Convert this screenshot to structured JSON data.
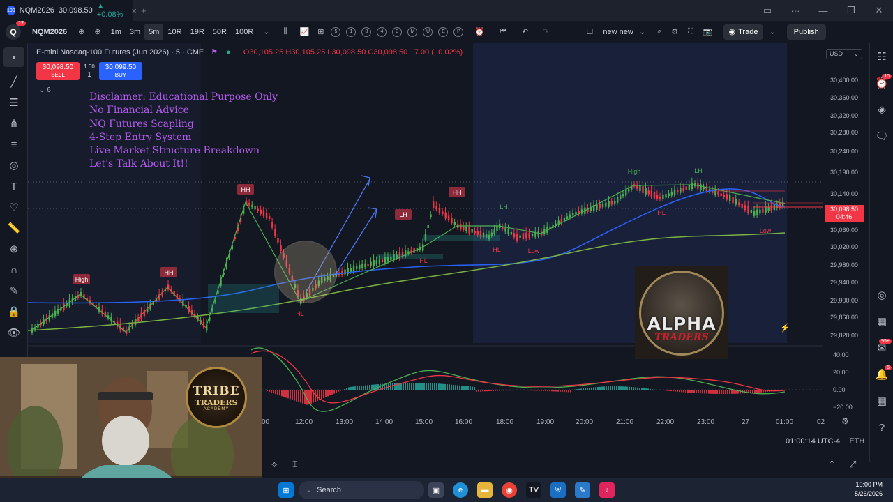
{
  "window": {
    "tab_title": "NQM2026",
    "tab_price": "30,098.50",
    "tab_change": "▲ +0.08%",
    "tab_icon": "100"
  },
  "toolbar": {
    "logo_badge": "12",
    "symbol": "NQM2026",
    "intervals": [
      "1m",
      "3m",
      "5m",
      "10R",
      "19R",
      "50R",
      "100R"
    ],
    "active_interval": "5m",
    "hotkeys": [
      "5",
      "1",
      "8",
      "4",
      "3",
      "M",
      "U",
      "E",
      "P"
    ],
    "layout_name": "new new",
    "trade_label": "Trade",
    "publish_label": "Publish"
  },
  "legend": {
    "title": "E-mini Nasdaq-100 Futures (Jun 2026) · 5 · CME",
    "ohlc": "O30,105.25 H30,105.25 L30,098.50 C30,098.50 −7.00 (−0.02%)"
  },
  "order": {
    "sell_price": "30,098.50",
    "sell_label": "SELL",
    "buy_price": "30,099.50",
    "buy_label": "BUY",
    "spread": "1.00",
    "qty": "1"
  },
  "collapsed_indicators": "⌄ 6",
  "disclaimer": [
    "Disclaimer: Educational Purpose Only",
    "No Financial Advice",
    "NQ Futures Scapling",
    "4-Step Entry System",
    "Live Market Structure Breakdown",
    "Let's Talk About It!!"
  ],
  "price_axis": {
    "currency": "USD",
    "ticks": [
      "30,400.00",
      "30,360.00",
      "30,320.00",
      "30,280.00",
      "30,240.00",
      "30,190.00",
      "30,140.00",
      "30,060.00",
      "30,020.00",
      "29,980.00",
      "29,940.00",
      "29,900.00",
      "29,860.00",
      "29,820.00"
    ],
    "last_price": "30,098.50",
    "countdown": "04:46",
    "macd_ticks": [
      "40.00",
      "20.00",
      "0.00",
      "−20.00"
    ]
  },
  "time_axis": [
    "00",
    "12:00",
    "13:00",
    "14:00",
    "15:00",
    "16:00",
    "18:00",
    "19:00",
    "20:00",
    "21:00",
    "22:00",
    "23:00",
    "27",
    "01:00",
    "02"
  ],
  "status": {
    "time": "01:00:14 UTC-4",
    "session": "ETH"
  },
  "structure_labels": {
    "high": "High",
    "hh": "HH",
    "lh": "LH",
    "hl": "HL",
    "low": "Low"
  },
  "overlay_logos": {
    "tribe_line1": "TRIBE",
    "tribe_line2": "TRADERS",
    "tribe_line3": "ACADEMY",
    "alpha_line1": "ALPHA",
    "alpha_line2": "TRADERS"
  },
  "taskbar": {
    "search_placeholder": "Search",
    "time": "10:00 PM",
    "date": "5/26/2026"
  },
  "right_badges": {
    "alerts": "10",
    "chat": "99+",
    "notifications": "5"
  },
  "colors": {
    "bull": "#26a69a",
    "bear": "#f23645",
    "bull_bright": "#4caf50",
    "ema_blue": "#2962ff",
    "ema_green": "#7cb342",
    "disclaimer": "#b55cf0",
    "background": "#131722"
  }
}
